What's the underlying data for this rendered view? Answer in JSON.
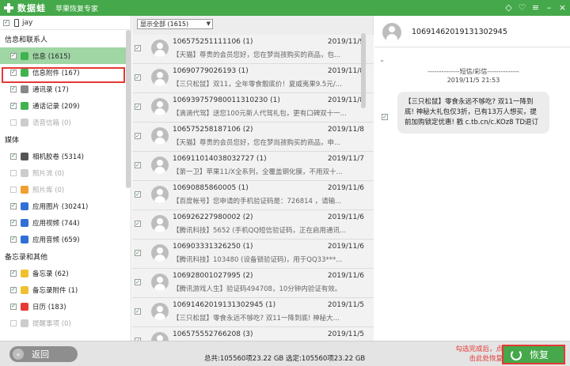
{
  "app": {
    "name": "数据蛙",
    "subtitle": "苹果恢复专家",
    "window_controls": [
      "diamond-icon",
      "heart-icon",
      "menu-icon",
      "minimize-icon",
      "close-icon"
    ],
    "accent_color": "#45a84a",
    "highlight_color": "#e53935"
  },
  "sidebar": {
    "device_name": "jay",
    "groups": [
      {
        "title": "信息和联系人",
        "items": [
          {
            "label": "信息 (1615)",
            "checked": true,
            "active": true,
            "icon": "message-icon",
            "icon_color": "#3fb34f"
          },
          {
            "label": "信息附件 (167)",
            "checked": true,
            "icon": "attachment-icon",
            "icon_color": "#3fb34f"
          },
          {
            "label": "通讯录 (17)",
            "checked": true,
            "icon": "contacts-icon",
            "icon_color": "#888888"
          },
          {
            "label": "通话记录 (209)",
            "checked": true,
            "icon": "phone-icon",
            "icon_color": "#3fb34f"
          },
          {
            "label": "语音信箱 (0)",
            "checked": false,
            "disabled": true,
            "icon": "voicemail-icon",
            "icon_color": "#cccccc"
          }
        ]
      },
      {
        "title": "媒体",
        "items": [
          {
            "label": "相机胶卷 (5314)",
            "checked": true,
            "icon": "camera-icon",
            "icon_color": "#555555"
          },
          {
            "label": "照片流 (0)",
            "checked": false,
            "disabled": true,
            "icon": "photostream-icon",
            "icon_color": "#cccccc"
          },
          {
            "label": "照片库 (0)",
            "checked": false,
            "disabled": true,
            "icon": "photos-icon",
            "icon_color": "#f0a030"
          },
          {
            "label": "应用图片 (30241)",
            "checked": true,
            "icon": "app-photo-icon",
            "icon_color": "#2f6fd6"
          },
          {
            "label": "应用视频 (744)",
            "checked": true,
            "icon": "app-video-icon",
            "icon_color": "#2f6fd6"
          },
          {
            "label": "应用音频 (659)",
            "checked": true,
            "icon": "app-audio-icon",
            "icon_color": "#2f6fd6"
          }
        ]
      },
      {
        "title": "备忘录和其他",
        "items": [
          {
            "label": "备忘录 (62)",
            "checked": true,
            "icon": "notes-icon",
            "icon_color": "#f0c030"
          },
          {
            "label": "备忘录附件 (1)",
            "checked": true,
            "icon": "notes-attachment-icon",
            "icon_color": "#f0c030"
          },
          {
            "label": "日历 (183)",
            "checked": true,
            "icon": "calendar-icon",
            "icon_color": "#e53935"
          },
          {
            "label": "提醒事项 (0)",
            "checked": false,
            "disabled": true,
            "icon": "reminders-icon",
            "icon_color": "#cccccc"
          }
        ]
      }
    ]
  },
  "list": {
    "filter": "显示全部 (1615)",
    "messages": [
      {
        "number": "106575251111106 (1)",
        "date": "2019/11/9",
        "preview": "【天猫】尊贵的会员您好，您在梦尚孩购买的商品，包...",
        "checked": true
      },
      {
        "number": "10690779026193 (1)",
        "date": "2019/11/8",
        "preview": "【三只松鼠】双11，全年零食靓底价！夏威夷果9.5元/...",
        "checked": true
      },
      {
        "number": "106939757980011310230 (1)",
        "date": "2019/11/8",
        "preview": "【滴滴代驾】送您100元新人代驾礼包，更有口碑双十一...",
        "checked": true
      },
      {
        "number": "106575258187106 (2)",
        "date": "2019/11/8",
        "preview": "【天猫】尊贵的会员您好，您在梦尚孩购买的商品，申...",
        "checked": true
      },
      {
        "number": "1069110140380327​27 (1)",
        "date": "2019/11/7",
        "preview": "【第一卫】苹果11/X全系列，全覆盖钢化膜，不用双十...",
        "checked": true
      },
      {
        "number": "10690885860005 (1)",
        "date": "2019/11/6",
        "preview": "【百度帐号】您申请的手机验证码是：726814 ，请输...",
        "checked": true
      },
      {
        "number": "106926227980002 (2)",
        "date": "2019/11/6",
        "preview": "【腾讯科技】5652 (手机QQ短信验证码，正在启用通讯...",
        "checked": true
      },
      {
        "number": "10690333132625​0 (1)",
        "date": "2019/11/6",
        "preview": "【腾讯科技】103480 (设备锁验证码)，用于QQ33***...",
        "checked": true
      },
      {
        "number": "106928001027995 (2)",
        "date": "2019/11/6",
        "preview": "【腾讯游戏人生】验证码494708，10分钟内验证有效。",
        "checked": true
      },
      {
        "number": "10691462019131302945 (1)",
        "date": "2019/11/5",
        "preview": "【三只松鼠】零食永远不够吃? 双11一降到底! 神秘大...",
        "checked": true
      },
      {
        "number": "106575552766208 (3)",
        "date": "2019/11/5",
        "preview": "",
        "checked": true
      }
    ]
  },
  "detail": {
    "contact_number": "10691462019131302945",
    "type_label": "--------------短信/彩信--------------",
    "time": "2019/11/5 21:53",
    "message": "【三只松鼠】零食永远不够吃? 双11一降到底! 神秘大礼包仅3折，已有13万人想买，提前加购锁定优惠! 戳 c.tb.cn/c.KOz8 TD退订"
  },
  "bottom": {
    "back_label": "返回",
    "totals": "总共:105560项23.22 GB 选定:105560项23.22 GB",
    "hint": "勾选完成后，点击此处恢复",
    "restore_label": "恢复"
  }
}
